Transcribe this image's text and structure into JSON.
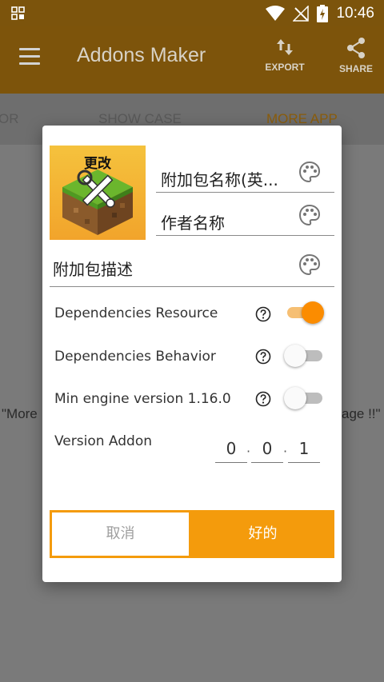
{
  "status_bar": {
    "time": "10:46"
  },
  "app_bar": {
    "title": "Addons Maker",
    "actions": [
      {
        "label": "EXPORT",
        "icon": "swap-vert-icon"
      },
      {
        "label": "SHARE",
        "icon": "share-icon"
      }
    ]
  },
  "tabs": [
    {
      "label": "OR"
    },
    {
      "label": "SHOW CASE"
    },
    {
      "label": "MORE APP",
      "active": true
    }
  ],
  "background_text": {
    "left": "\"More",
    "right": "age !!\""
  },
  "dialog": {
    "thumbnail_label": "更改",
    "name_field": "附加包名称(英...",
    "author_field": "作者名称",
    "description_field": "附加包描述",
    "options": [
      {
        "label": "Dependencies Resource",
        "enabled": true
      },
      {
        "label": "Dependencies Behavior",
        "enabled": false
      },
      {
        "label": "Min engine version 1.16.0",
        "enabled": false
      }
    ],
    "version": {
      "label": "Version Addon",
      "parts": [
        "0",
        "0",
        "1"
      ],
      "separator": "·"
    },
    "cancel_label": "取消",
    "ok_label": "好的"
  },
  "colors": {
    "accent": "#f49b0c",
    "switch_on": "#fb8c00",
    "app_bar": "#7d540b"
  }
}
